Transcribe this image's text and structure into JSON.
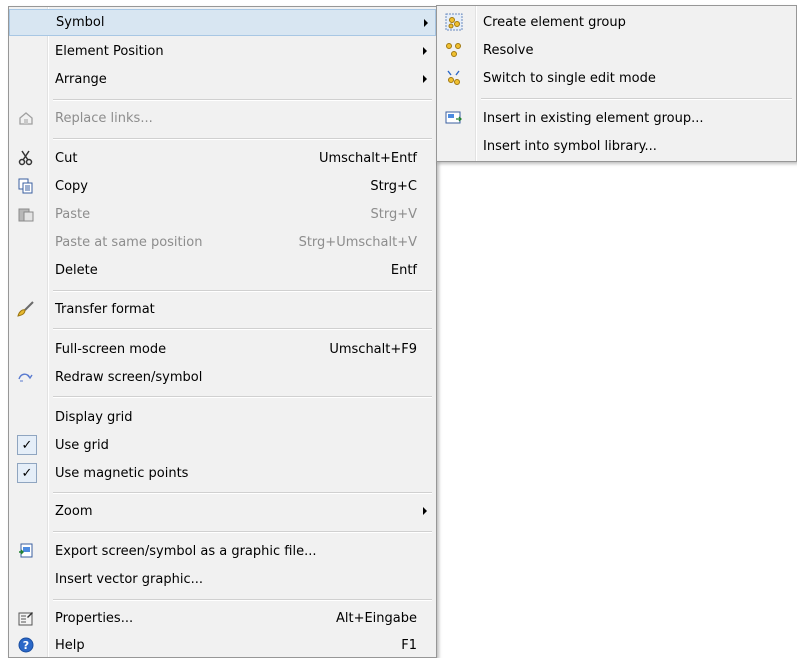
{
  "main_menu": {
    "items": [
      {
        "label": "Symbol",
        "submenu": true,
        "highlight": true
      },
      {
        "label": "Element Position",
        "submenu": true
      },
      {
        "label": "Arrange",
        "submenu": true
      },
      {
        "label": "Replace links...",
        "disabled": true,
        "icon": "replace-links-icon"
      },
      {
        "label": "Cut",
        "shortcut": "Umschalt+Entf",
        "icon": "scissors-icon"
      },
      {
        "label": "Copy",
        "shortcut": "Strg+C",
        "icon": "copy-icon"
      },
      {
        "label": "Paste",
        "shortcut": "Strg+V",
        "disabled": true,
        "icon": "paste-icon"
      },
      {
        "label": "Paste at same position",
        "shortcut": "Strg+Umschalt+V",
        "disabled": true
      },
      {
        "label": "Delete",
        "shortcut": "Entf"
      },
      {
        "label": "Transfer format",
        "icon": "paintbrush-icon"
      },
      {
        "label": "Full-screen mode",
        "shortcut": "Umschalt+F9"
      },
      {
        "label": "Redraw screen/symbol",
        "icon": "redraw-icon"
      },
      {
        "label": "Display grid"
      },
      {
        "label": "Use grid",
        "checked": true
      },
      {
        "label": "Use magnetic points",
        "checked": true
      },
      {
        "label": "Zoom",
        "submenu": true
      },
      {
        "label": "Export screen/symbol as a graphic file...",
        "icon": "export-graphic-icon"
      },
      {
        "label": "Insert vector graphic..."
      },
      {
        "label": "Properties...",
        "shortcut": "Alt+Eingabe",
        "icon": "properties-icon"
      },
      {
        "label": "Help",
        "shortcut": "F1",
        "icon": "help-icon"
      }
    ]
  },
  "submenu": {
    "items": [
      {
        "label": "Create element group",
        "icon": "create-group-icon"
      },
      {
        "label": "Resolve",
        "icon": "resolve-icon"
      },
      {
        "label": "Switch to single edit mode",
        "icon": "single-edit-icon"
      },
      {
        "label": "Insert in existing element group...",
        "icon": "insert-group-icon"
      },
      {
        "label": "Insert into symbol library..."
      }
    ]
  },
  "colors": {
    "menu_bg": "#f1f1f1",
    "highlight_bg": "#d8e6f2",
    "disabled_text": "#8d8d8d"
  }
}
